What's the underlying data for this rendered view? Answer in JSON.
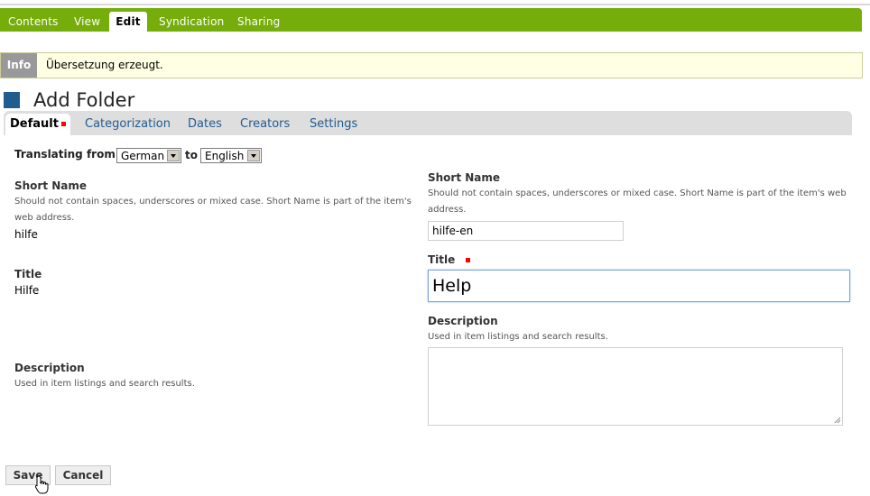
{
  "views": {
    "tabs": [
      {
        "label": "Contents",
        "active": false
      },
      {
        "label": "View",
        "active": false
      },
      {
        "label": "Edit",
        "active": true
      },
      {
        "label": "Syndication",
        "active": false
      },
      {
        "label": "Sharing",
        "active": false
      }
    ]
  },
  "message": {
    "type": "Info",
    "text": "Übersetzung erzeugt."
  },
  "page": {
    "title": "Add Folder"
  },
  "fieldset_tabs": [
    {
      "label": "Default",
      "active": true,
      "required": true
    },
    {
      "label": "Categorization"
    },
    {
      "label": "Dates"
    },
    {
      "label": "Creators"
    },
    {
      "label": "Settings"
    }
  ],
  "translating": {
    "label": "Translating from",
    "from": "German",
    "to_label": "to",
    "to": "English"
  },
  "source": {
    "short_name": {
      "label": "Short Name",
      "help": "Should not contain spaces, underscores or mixed case. Short Name is part of the item's web address.",
      "value": "hilfe"
    },
    "title": {
      "label": "Title",
      "value": "Hilfe"
    },
    "description": {
      "label": "Description",
      "help": "Used in item listings and search results."
    }
  },
  "target": {
    "short_name": {
      "label": "Short Name",
      "help": "Should not contain spaces, underscores or mixed case. Short Name is part of the item's web address.",
      "value": "hilfe-en"
    },
    "title": {
      "label": "Title",
      "value": "Help",
      "required": true
    },
    "description": {
      "label": "Description",
      "help": "Used in item listings and search results.",
      "value": ""
    }
  },
  "buttons": {
    "save": "Save",
    "cancel": "Cancel"
  },
  "colors": {
    "views_bar": "#75ad0a",
    "link": "#205c90",
    "required": "#ff0000",
    "info_bg": "#ffffe3"
  }
}
